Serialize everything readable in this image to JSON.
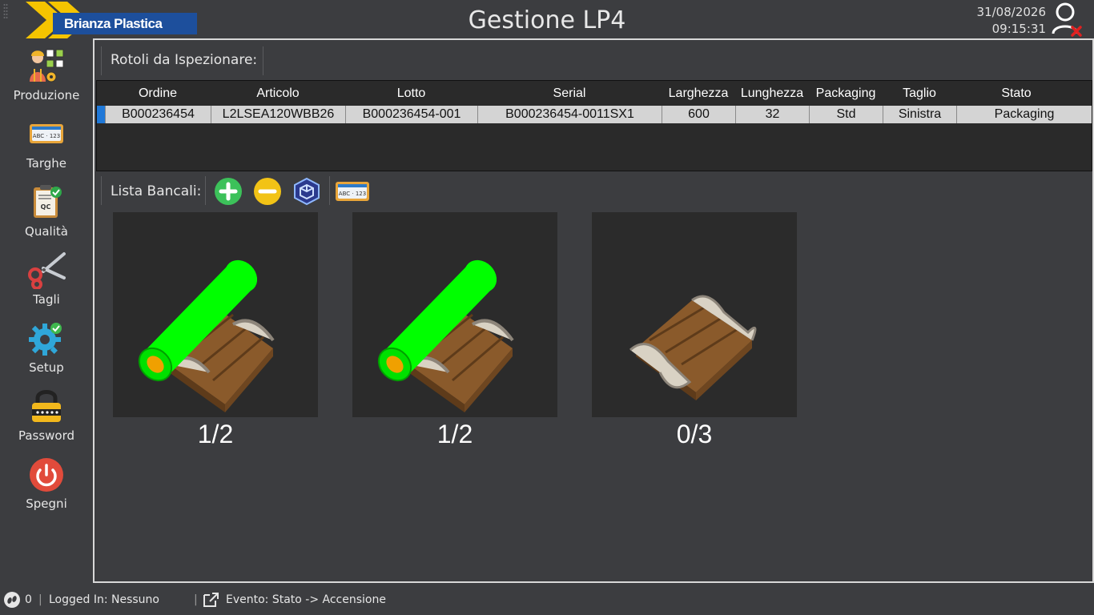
{
  "header": {
    "brand": "Brianza Plastica",
    "title": "Gestione LP4",
    "date": "31/08/2026",
    "time": "09:15:31"
  },
  "sidebar": {
    "items": [
      {
        "label": "Produzione",
        "icon": "worker-icon"
      },
      {
        "label": "Targhe",
        "icon": "license-plate-icon"
      },
      {
        "label": "Qualità",
        "icon": "qc-clipboard-icon"
      },
      {
        "label": "Tagli",
        "icon": "scissors-icon"
      },
      {
        "label": "Setup",
        "icon": "gear-icon"
      },
      {
        "label": "Password",
        "icon": "padlock-icon"
      },
      {
        "label": "Spegni",
        "icon": "power-icon"
      }
    ]
  },
  "rotoli": {
    "label": "Rotoli da Ispezionare:",
    "columns": [
      "Ordine",
      "Articolo",
      "Lotto",
      "Serial",
      "Larghezza",
      "Lunghezza",
      "Packaging",
      "Taglio",
      "Stato"
    ],
    "rows": [
      [
        "B000236454",
        "L2LSEA120WBB26",
        "B000236454-001",
        "B000236454-0011SX1",
        "600",
        "32",
        "Std",
        "Sinistra",
        "Packaging"
      ]
    ]
  },
  "bancali": {
    "label": "Lista Bancali:",
    "tools": [
      "add-icon",
      "remove-icon",
      "cube-icon",
      "license-plate-icon"
    ],
    "pallets": [
      {
        "count": "1/2",
        "loaded": true
      },
      {
        "count": "1/2",
        "loaded": true
      },
      {
        "count": "0/3",
        "loaded": false
      }
    ]
  },
  "status": {
    "counter": "0",
    "logged_in": "Logged In: Nessuno",
    "event": "Evento: Stato -> Accensione"
  },
  "colors": {
    "accent": "#1f78d8",
    "roll": "#00ff00",
    "add": "#3cc15a",
    "remove": "#f2c316",
    "power": "#e14b3b"
  }
}
